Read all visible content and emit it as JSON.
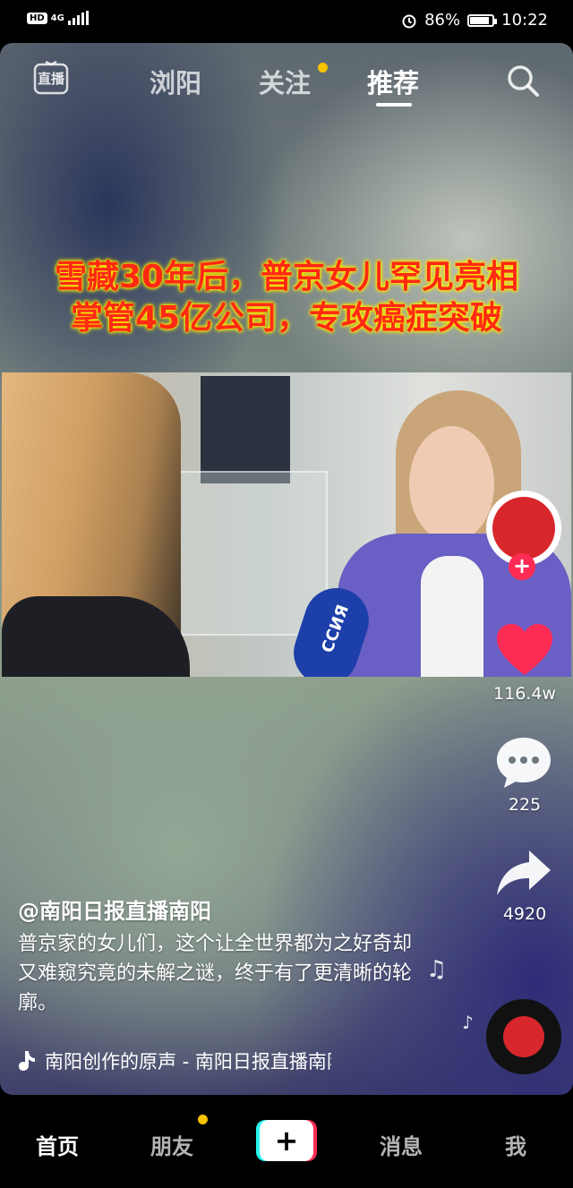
{
  "status_bar": {
    "network_badge": "HD",
    "network_type": "4G",
    "battery_percent": "86%",
    "battery_level": 0.86,
    "time": "10:22",
    "icons": [
      "alarm-icon",
      "signal-icon",
      "battery-icon"
    ]
  },
  "top_nav": {
    "live_label": "直播",
    "tabs": [
      {
        "label": "浏阳",
        "active": false
      },
      {
        "label": "关注",
        "active": false,
        "badge": "yellow-dot"
      },
      {
        "label": "推荐",
        "active": true
      }
    ],
    "search_icon": "search-icon"
  },
  "video": {
    "headline_lines": [
      "雪藏30年后，普京女儿罕见亮相",
      "掌管45亿公司，专攻癌症突破"
    ],
    "mic_text": "ССИЯ"
  },
  "actions": {
    "follow_label": "+",
    "likes": "116.4w",
    "comments": "225",
    "shares": "4920"
  },
  "post": {
    "author": "@南阳日报直播南阳",
    "description": "普京家的女儿们，这个让全世界都为之好奇却又难窥究竟的未解之谜，终于有了更清晰的轮廓。",
    "music": "南阳创作的原声 - 南阳日报直播南阳"
  },
  "bottom_nav": {
    "items": [
      {
        "label": "首页",
        "active": true
      },
      {
        "label": "朋友",
        "badge": "yellow-dot"
      },
      {
        "label": "+"
      },
      {
        "label": "消息"
      },
      {
        "label": "我"
      }
    ]
  },
  "colors": {
    "accent_red": "#fe2c55",
    "accent_cyan": "#25f4ee",
    "badge_yellow": "#f8c200",
    "headline_red": "#ff2a14"
  }
}
